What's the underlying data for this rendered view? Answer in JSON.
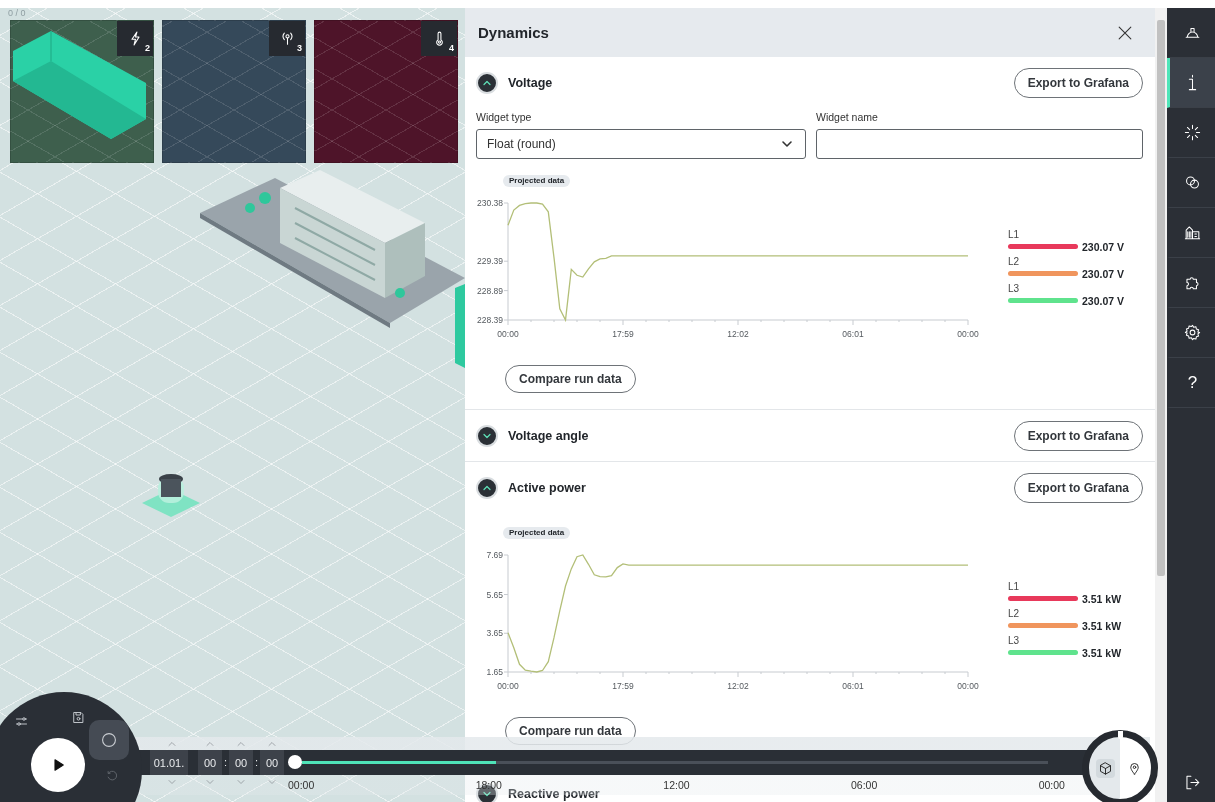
{
  "canvas": {
    "counter": "0 / 0",
    "thumbnails": [
      {
        "kind": "power",
        "badge": "2",
        "color": "#3e5f4d"
      },
      {
        "kind": "signal",
        "badge": "3",
        "color": "#35495a"
      },
      {
        "kind": "temperature",
        "badge": "4",
        "color": "#4e1429"
      }
    ]
  },
  "panel": {
    "title": "Dynamics",
    "sections": [
      {
        "title": "Voltage",
        "expanded": true,
        "export_button": "Export to Grafana",
        "widget_type": {
          "label": "Widget type",
          "value": "Float (round)"
        },
        "widget_name": {
          "label": "Widget name"
        },
        "chart_data": {
          "type": "line",
          "categories": [
            "00:00",
            null,
            null,
            null,
            null,
            null,
            null,
            null,
            null,
            null,
            null,
            null,
            null,
            null,
            null,
            null,
            null,
            null,
            null,
            null,
            "17:59",
            null,
            null,
            null,
            null,
            null,
            null,
            null,
            null,
            null,
            null,
            null,
            null,
            null,
            null,
            null,
            null,
            null,
            null,
            null,
            "12:02",
            null,
            null,
            null,
            null,
            null,
            null,
            null,
            null,
            null,
            null,
            null,
            null,
            null,
            null,
            null,
            null,
            null,
            null,
            null,
            "06:01",
            null,
            null,
            null,
            null,
            null,
            null,
            null,
            null,
            null,
            null,
            null,
            null,
            null,
            null,
            null,
            null,
            null,
            null,
            null,
            "00:00"
          ],
          "ylim": [
            228.39,
            230.38
          ],
          "yticks": [
            230.38,
            229.39,
            228.89,
            228.39
          ],
          "series": [
            {
              "name": "Projected data",
              "color": "#b3bf78",
              "values": [
                230.0,
                230.26,
                230.34,
                230.37,
                230.38,
                230.38,
                230.36,
                230.23,
                229.45,
                228.58,
                228.39,
                229.25,
                229.15,
                229.12,
                229.26,
                229.38,
                229.43,
                229.44,
                229.48,
                229.48,
                229.48,
                229.48,
                229.48,
                229.48,
                229.48,
                229.48,
                229.48,
                229.48,
                229.48,
                229.48,
                229.48,
                229.48,
                229.48,
                229.48,
                229.48,
                229.48,
                229.48,
                229.48,
                229.48,
                229.48,
                229.48,
                229.48,
                229.48,
                229.48,
                229.48,
                229.48,
                229.48,
                229.48,
                229.48,
                229.48,
                229.48,
                229.48,
                229.48,
                229.48,
                229.48,
                229.48,
                229.48,
                229.48,
                229.48,
                229.48,
                229.48,
                229.48,
                229.48,
                229.48,
                229.48,
                229.48,
                229.48,
                229.48,
                229.48,
                229.48,
                229.48,
                229.48,
                229.48,
                229.48,
                229.48,
                229.48,
                229.48,
                229.48,
                229.48,
                229.48,
                229.48
              ]
            }
          ]
        },
        "legend": [
          {
            "label": "L1",
            "color": "#e8395b",
            "reading": "230.07 V"
          },
          {
            "label": "L2",
            "color": "#f0955d",
            "reading": "230.07 V"
          },
          {
            "label": "L3",
            "color": "#5fe38d",
            "reading": "230.07 V"
          }
        ],
        "compare_button": "Compare run data"
      },
      {
        "title": "Voltage angle",
        "expanded": false,
        "export_button": "Export to Grafana"
      },
      {
        "title": "Active power",
        "expanded": true,
        "export_button": "Export to Grafana",
        "chart_data": {
          "type": "line",
          "categories": [
            "00:00",
            null,
            null,
            null,
            null,
            null,
            null,
            null,
            null,
            null,
            null,
            null,
            null,
            null,
            null,
            null,
            null,
            null,
            null,
            null,
            "17:59",
            null,
            null,
            null,
            null,
            null,
            null,
            null,
            null,
            null,
            null,
            null,
            null,
            null,
            null,
            null,
            null,
            null,
            null,
            null,
            "12:02",
            null,
            null,
            null,
            null,
            null,
            null,
            null,
            null,
            null,
            null,
            null,
            null,
            null,
            null,
            null,
            null,
            null,
            null,
            null,
            "06:01",
            null,
            null,
            null,
            null,
            null,
            null,
            null,
            null,
            null,
            null,
            null,
            null,
            null,
            null,
            null,
            null,
            null,
            null,
            null,
            "00:00"
          ],
          "ylim": [
            1.65,
            7.69
          ],
          "yticks": [
            7.69,
            5.65,
            3.65,
            1.65
          ],
          "series": [
            {
              "name": "Projected data",
              "color": "#b3bf78",
              "values": [
                3.68,
                2.9,
                2.05,
                1.75,
                1.69,
                1.65,
                1.73,
                2.18,
                3.42,
                4.82,
                6.09,
                6.97,
                7.6,
                7.69,
                7.21,
                6.67,
                6.57,
                6.56,
                6.62,
                7.04,
                7.23,
                7.17,
                7.17,
                7.17,
                7.17,
                7.17,
                7.17,
                7.17,
                7.17,
                7.17,
                7.17,
                7.17,
                7.17,
                7.17,
                7.17,
                7.17,
                7.17,
                7.17,
                7.17,
                7.17,
                7.17,
                7.17,
                7.17,
                7.17,
                7.17,
                7.17,
                7.17,
                7.17,
                7.17,
                7.17,
                7.17,
                7.17,
                7.17,
                7.17,
                7.17,
                7.17,
                7.17,
                7.17,
                7.17,
                7.17,
                7.17,
                7.17,
                7.17,
                7.17,
                7.17,
                7.17,
                7.17,
                7.17,
                7.17,
                7.17,
                7.17,
                7.17,
                7.17,
                7.17,
                7.17,
                7.17,
                7.17,
                7.17,
                7.17,
                7.17,
                7.17
              ]
            }
          ]
        },
        "legend": [
          {
            "label": "L1",
            "color": "#e8395b",
            "reading": "3.51 kW"
          },
          {
            "label": "L2",
            "color": "#f0955d",
            "reading": "3.51 kW"
          },
          {
            "label": "L3",
            "color": "#5fe38d",
            "reading": "3.51 kW"
          }
        ],
        "compare_button": "Compare run data"
      },
      {
        "title": "Reactive power",
        "expanded": false
      }
    ]
  },
  "dial": {
    "items": [
      {
        "kind": "sliders",
        "selected": false,
        "disabled": false
      },
      {
        "kind": "save",
        "selected": false,
        "disabled": false
      },
      {
        "kind": "circle",
        "selected": true,
        "disabled": false
      },
      {
        "kind": "undo",
        "selected": false,
        "disabled": true
      }
    ]
  },
  "timeline": {
    "date": "01.01.",
    "hours": "00",
    "minutes": "00",
    "seconds": "00",
    "separators": [
      ":",
      ":"
    ],
    "level": 0.26,
    "ticks": [
      "00:00",
      "18:00",
      "12:00",
      "06:00",
      "00:00"
    ]
  },
  "compass": {
    "modes": [
      {
        "kind": "cube",
        "selected": true
      },
      {
        "kind": "pin",
        "selected": false
      }
    ]
  },
  "sidebar": {
    "items": [
      {
        "kind": "helmet",
        "selected": false
      },
      {
        "kind": "info",
        "selected": true
      },
      {
        "kind": "loading",
        "selected": false
      },
      {
        "kind": "circles",
        "selected": false
      },
      {
        "kind": "buildings",
        "selected": false
      },
      {
        "kind": "puzzle",
        "selected": false
      },
      {
        "kind": "gear",
        "selected": false
      },
      {
        "kind": "help",
        "glyph": "?",
        "selected": false
      }
    ],
    "footer": {
      "kind": "logout"
    }
  }
}
